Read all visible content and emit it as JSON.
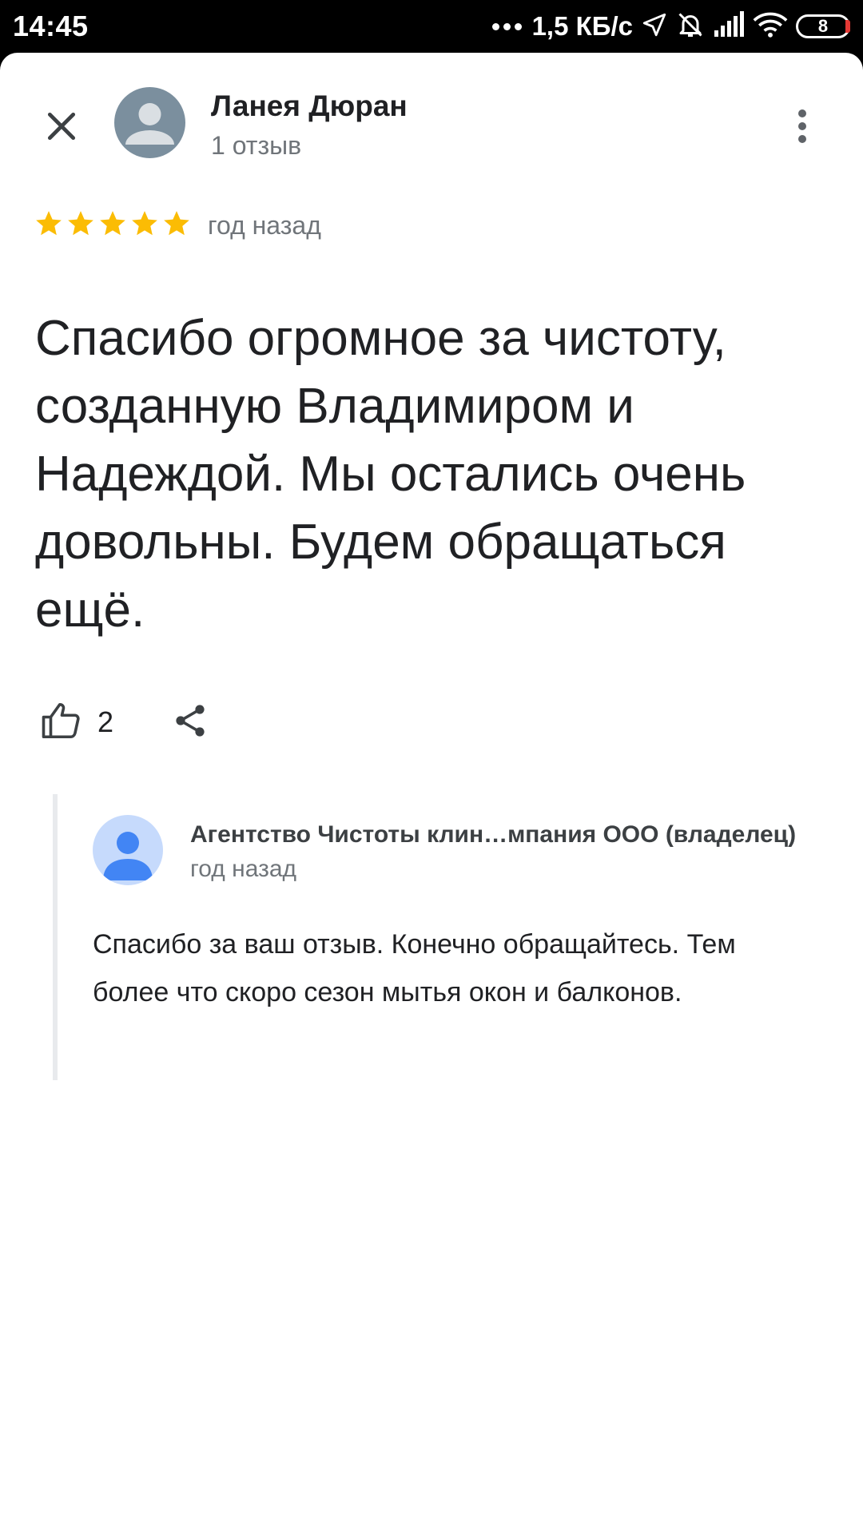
{
  "status_bar": {
    "time": "14:45",
    "network_speed": "1,5 КБ/с",
    "battery_level": "8",
    "icons": [
      "dots-icon",
      "location-arrow-icon",
      "bell-off-icon",
      "signal-icon",
      "wifi-icon",
      "battery-icon"
    ]
  },
  "header": {
    "close_icon": "close-icon",
    "reviewer_name": "Ланея Дюран",
    "reviewer_reviews": "1 отзыв",
    "menu_icon": "more-vert-icon"
  },
  "review": {
    "rating": 5,
    "rating_max": 5,
    "star_color": "#fbbc04",
    "date": "год назад",
    "text": "Спасибо огромное за чистоту, созданную Владимиром и Надеждой. Мы остались очень довольны. Будем обращаться ещё.",
    "likes": "2",
    "like_icon": "thumb-up-icon",
    "share_icon": "share-icon"
  },
  "owner_reply": {
    "name": "Агентство Чистоты клин…мпания ООО (владелец)",
    "date": "год назад",
    "text": "Спасибо за ваш отзыв. Конечно обращайтесь. Тем более что скоро сезон мытья окон и балконов.",
    "avatar_color": "#4285f4"
  }
}
